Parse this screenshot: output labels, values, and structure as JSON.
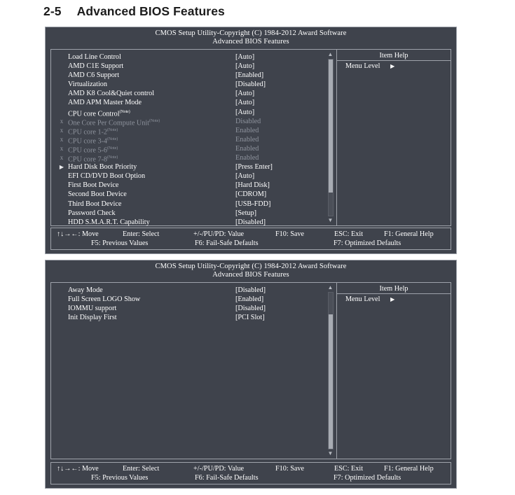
{
  "heading": {
    "section_number": "2-5",
    "title": "Advanced BIOS Features"
  },
  "bios_title": {
    "line1": "CMOS Setup Utility-Copyright (C) 1984-2012 Award Software",
    "line2": "Advanced BIOS Features"
  },
  "help": {
    "title": "Item Help",
    "menu_level_label": "Menu Level",
    "menu_level_arrow": "▶"
  },
  "scroll": {
    "up_arrow": "▲",
    "down_arrow": "▼"
  },
  "footer": {
    "row1": {
      "move": "↑↓→←: Move",
      "enter": "Enter: Select",
      "value": "+/-/PU/PD: Value",
      "save": "F10: Save",
      "exit": "ESC: Exit",
      "help": "F1: General Help"
    },
    "row2": {
      "previous": "F5: Previous Values",
      "failsafe": "F6: Fail-Safe Defaults",
      "optimized": "F7: Optimized Defaults"
    }
  },
  "panel1": {
    "scroll_thumb_percent": 85,
    "items": [
      {
        "marker": "",
        "label": "Load Line Control",
        "note": false,
        "value": "[Auto]",
        "dim": false
      },
      {
        "marker": "",
        "label": "AMD C1E Support",
        "note": false,
        "value": "[Auto]",
        "dim": false
      },
      {
        "marker": "",
        "label": "AMD C6 Support",
        "note": false,
        "value": "[Enabled]",
        "dim": false
      },
      {
        "marker": "",
        "label": "Virtualization",
        "note": false,
        "value": "[Disabled]",
        "dim": false
      },
      {
        "marker": "",
        "label": "AMD K8 Cool&Quiet control",
        "note": false,
        "value": "[Auto]",
        "dim": false
      },
      {
        "marker": "",
        "label": "AMD APM Master Mode",
        "note": false,
        "value": "[Auto]",
        "dim": false
      },
      {
        "marker": "",
        "label": "CPU core Control",
        "note": true,
        "value": "[Auto]",
        "dim": false
      },
      {
        "marker": "x",
        "label": "One Core Per Compute Unit",
        "note": true,
        "value": "Disabled",
        "dim": true
      },
      {
        "marker": "x",
        "label": "CPU core 1-2",
        "note": true,
        "value": "Enabled",
        "dim": true
      },
      {
        "marker": "x",
        "label": "CPU core 3-4",
        "note": true,
        "value": "Enabled",
        "dim": true
      },
      {
        "marker": "x",
        "label": "CPU core 5-6",
        "note": true,
        "value": "Enabled",
        "dim": true
      },
      {
        "marker": "x",
        "label": "CPU core 7-8",
        "note": true,
        "value": "Enabled",
        "dim": true
      },
      {
        "marker": "▶",
        "label": "Hard Disk Boot Priority",
        "note": false,
        "value": "[Press Enter]",
        "dim": false
      },
      {
        "marker": "",
        "label": "EFI CD/DVD Boot Option",
        "note": false,
        "value": "[Auto]",
        "dim": false
      },
      {
        "marker": "",
        "label": "First Boot Device",
        "note": false,
        "value": "[Hard Disk]",
        "dim": false
      },
      {
        "marker": "",
        "label": "Second Boot Device",
        "note": false,
        "value": "[CDROM]",
        "dim": false
      },
      {
        "marker": "",
        "label": "Third Boot Device",
        "note": false,
        "value": "[USB-FDD]",
        "dim": false
      },
      {
        "marker": "",
        "label": "Password Check",
        "note": false,
        "value": "[Setup]",
        "dim": false
      },
      {
        "marker": "",
        "label": "HDD S.M.A.R.T. Capability",
        "note": false,
        "value": "[Disabled]",
        "dim": false
      }
    ]
  },
  "panel2": {
    "scroll_gap_percent": 14,
    "items": [
      {
        "marker": "",
        "label": "Away Mode",
        "note": false,
        "value": "[Disabled]",
        "dim": false
      },
      {
        "marker": "",
        "label": "Full Screen LOGO Show",
        "note": false,
        "value": "[Enabled]",
        "dim": false
      },
      {
        "marker": "",
        "label": "IOMMU support",
        "note": false,
        "value": "[Disabled]",
        "dim": false
      },
      {
        "marker": "",
        "label": "Init Display First",
        "note": false,
        "value": "[PCI Slot]",
        "dim": false
      }
    ]
  },
  "note_marker": "(Note)"
}
